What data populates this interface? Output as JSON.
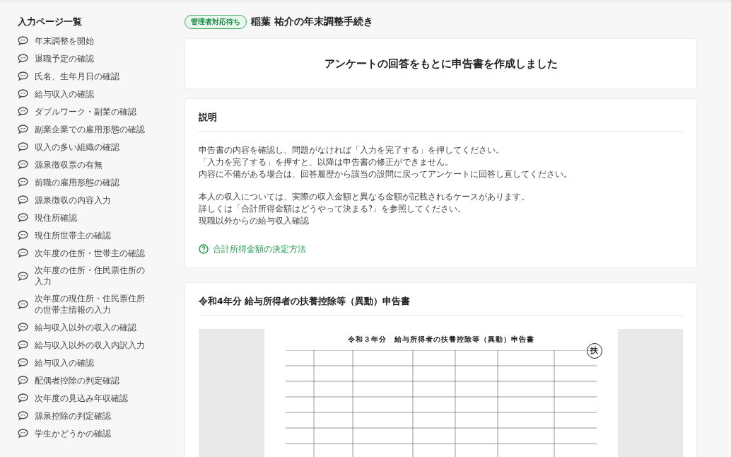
{
  "sidebar": {
    "title": "入力ページ一覧",
    "items": [
      {
        "label": "年末調整を開始"
      },
      {
        "label": "退職予定の確認"
      },
      {
        "label": "氏名、生年月日の確認"
      },
      {
        "label": "給与収入の確認"
      },
      {
        "label": "ダブルワーク・副業の確認"
      },
      {
        "label": "副業企業での雇用形態の確認"
      },
      {
        "label": "収入の多い組織の確認"
      },
      {
        "label": "源泉徴収票の有無"
      },
      {
        "label": "前職の雇用形態の確認"
      },
      {
        "label": "源泉徴収の内容入力"
      },
      {
        "label": "現住所確認"
      },
      {
        "label": "現住所世帯主の確認"
      },
      {
        "label": "次年度の住所・世帯主の確認"
      },
      {
        "label": "次年度の住所・住民票住所の入力"
      },
      {
        "label": "次年度の現住所・住民票住所の世帯主情報の入力"
      },
      {
        "label": "給与収入以外の収入の確認"
      },
      {
        "label": "給与収入以外の収入内訳入力"
      },
      {
        "label": "給与収入の確認"
      },
      {
        "label": "配偶者控除の判定確認"
      },
      {
        "label": "次年度の見込み年収確認"
      },
      {
        "label": "源泉控除の判定確認"
      },
      {
        "label": "学生かどうかの確認"
      }
    ]
  },
  "header": {
    "status_badge": "管理者対応待ち",
    "title": "稲葉 祐介の年末調整手続き"
  },
  "result_card": {
    "message": "アンケートの回答をもとに申告書を作成しました"
  },
  "explanation_card": {
    "title": "説明",
    "paragraphs": [
      [
        "申告書の内容を確認し、問題がなければ「入力を完了する」を押してください。",
        "「入力を完了する」を押すと、以降は申告書の修正ができません。",
        "内容に不備がある場合は、回答履歴から該当の設問に戻ってアンケートに回答し直してください。"
      ],
      [
        "本人の収入については、実際の収入金額と異なる金額が記載されるケースがあります。",
        "詳しくは「合計所得金額はどうやって決まる?」を参照してください。",
        "現職以外からの給与収入確認"
      ]
    ],
    "link": "合計所得金額の決定方法"
  },
  "form_card": {
    "title": "令和4年分 給与所得者の扶養控除等（異動）申告書",
    "document": {
      "heading": "令和３年分　給与所得者の扶養控除等（異動）申告書",
      "stamp": "扶"
    }
  }
}
